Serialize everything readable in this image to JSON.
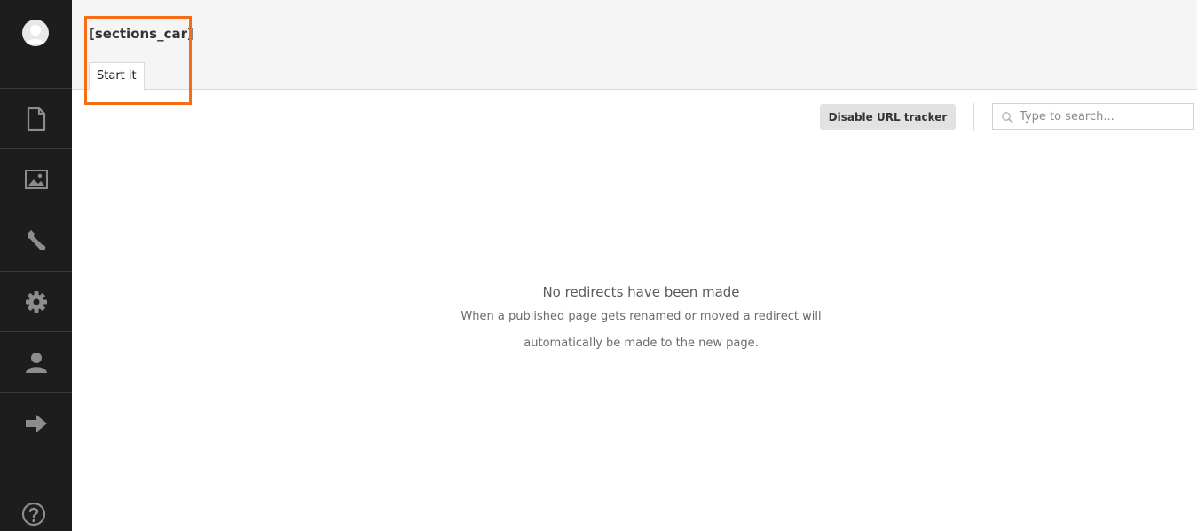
{
  "header": {
    "title": "[sections_car]",
    "tabs": [
      {
        "label": "Start it"
      }
    ]
  },
  "sidebar": {
    "items": [
      {
        "name": "content",
        "icon": "document-icon"
      },
      {
        "name": "media",
        "icon": "image-icon"
      },
      {
        "name": "developer",
        "icon": "wrench-icon"
      },
      {
        "name": "settings",
        "icon": "gear-icon"
      },
      {
        "name": "users",
        "icon": "user-icon"
      },
      {
        "name": "redirects",
        "icon": "arrow-right-icon"
      }
    ],
    "help_icon": "help-icon"
  },
  "toolbar": {
    "disable_label": "Disable URL tracker",
    "search_placeholder": "Type to search..."
  },
  "empty_state": {
    "title": "No redirects have been made",
    "description": "When a published page gets renamed or moved a redirect will automatically be made to the new page."
  },
  "colors": {
    "sidebar_bg": "#1d1d1d",
    "icon": "#8d8d8d",
    "highlight": "#f46e16",
    "header_bg": "#f5f5f5"
  }
}
